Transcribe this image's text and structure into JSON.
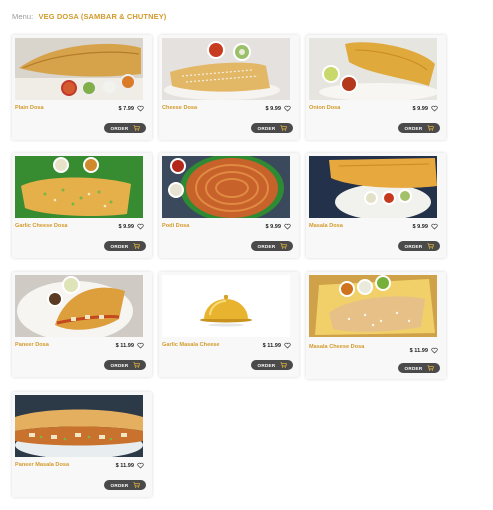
{
  "breadcrumb": {
    "menu_label": "Menu:",
    "category": "VEG DOSA (SAMBAR & CHUTNEY)"
  },
  "order_label": "ORDER",
  "colors": {
    "accent": "#d39b2c",
    "button": "#4a4a4a",
    "card_bg": "#f8f8f8"
  },
  "items": [
    {
      "name": "Plain Dosa",
      "price": "$ 7.99"
    },
    {
      "name": "Cheese Dosa",
      "price": "$ 9.99"
    },
    {
      "name": "Onion Dosa",
      "price": "$ 9.99"
    },
    {
      "name": "Garlic Cheese Dosa",
      "price": "$ 9.99"
    },
    {
      "name": "Podi Dosa",
      "price": "$ 9.99"
    },
    {
      "name": "Masala Dosa",
      "price": "$ 9.99"
    },
    {
      "name": "Paneer Dosa",
      "price": "$ 11.99"
    },
    {
      "name": "Garlic Masala Cheese",
      "price": "$ 11.99"
    },
    {
      "name": "Masala Cheese Dosa",
      "price": "$ 11.99"
    },
    {
      "name": "Paneer Masala Dosa",
      "price": "$ 11.99"
    }
  ]
}
